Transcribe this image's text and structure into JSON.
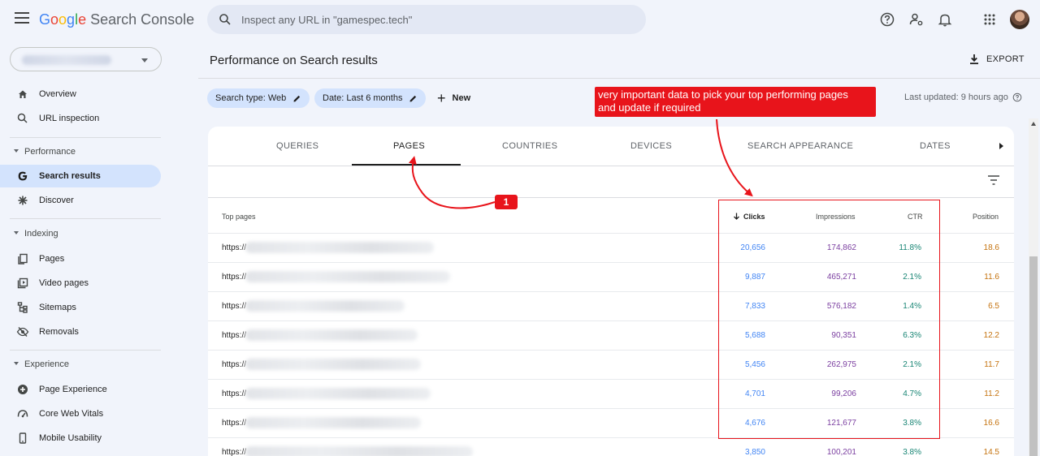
{
  "header": {
    "logo_google": [
      "G",
      "o",
      "o",
      "g",
      "l",
      "e"
    ],
    "logo_product": "Search Console",
    "search_placeholder": "Inspect any URL in \"gamespec.tech\""
  },
  "sidebar": {
    "items": [
      {
        "label": "Overview",
        "icon": "home-icon"
      },
      {
        "label": "URL inspection",
        "icon": "search-icon"
      }
    ],
    "sections": [
      {
        "label": "Performance",
        "items": [
          {
            "label": "Search results",
            "icon": "google-g-icon",
            "active": true
          },
          {
            "label": "Discover",
            "icon": "asterisk-icon"
          }
        ]
      },
      {
        "label": "Indexing",
        "items": [
          {
            "label": "Pages",
            "icon": "pages-icon"
          },
          {
            "label": "Video pages",
            "icon": "video-pages-icon"
          },
          {
            "label": "Sitemaps",
            "icon": "sitemap-icon"
          },
          {
            "label": "Removals",
            "icon": "removals-icon"
          }
        ]
      },
      {
        "label": "Experience",
        "items": [
          {
            "label": "Page Experience",
            "icon": "page-experience-icon"
          },
          {
            "label": "Core Web Vitals",
            "icon": "speed-gauge-icon"
          },
          {
            "label": "Mobile Usability",
            "icon": "phone-icon"
          }
        ]
      }
    ]
  },
  "main": {
    "title": "Performance on Search results",
    "export_label": "EXPORT",
    "chips": [
      "Search type: Web",
      "Date: Last 6 months"
    ],
    "new_label": "New",
    "last_updated": "Last updated: 9 hours ago",
    "annotation_text_line1": "very important data to pick your top performing pages",
    "annotation_text_line2": "and update if required",
    "annotation_badge": "1",
    "tabs": [
      "QUERIES",
      "PAGES",
      "COUNTRIES",
      "DEVICES",
      "SEARCH APPEARANCE",
      "DATES"
    ],
    "active_tab": "PAGES",
    "table": {
      "headers": {
        "pages": "Top pages",
        "clicks": "Clicks",
        "impressions": "Impressions",
        "ctr": "CTR",
        "position": "Position"
      },
      "rows": [
        {
          "url": "https://",
          "clicks": "20,656",
          "impressions": "174,862",
          "ctr": "11.8%",
          "position": "18.6"
        },
        {
          "url": "https://",
          "clicks": "9,887",
          "impressions": "465,271",
          "ctr": "2.1%",
          "position": "11.6"
        },
        {
          "url": "https://",
          "clicks": "7,833",
          "impressions": "576,182",
          "ctr": "1.4%",
          "position": "6.5"
        },
        {
          "url": "https://",
          "clicks": "5,688",
          "impressions": "90,351",
          "ctr": "6.3%",
          "position": "12.2"
        },
        {
          "url": "https://",
          "clicks": "5,456",
          "impressions": "262,975",
          "ctr": "2.1%",
          "position": "11.7"
        },
        {
          "url": "https://",
          "clicks": "4,701",
          "impressions": "99,206",
          "ctr": "4.7%",
          "position": "11.2"
        },
        {
          "url": "https://",
          "clicks": "4,676",
          "impressions": "121,677",
          "ctr": "3.8%",
          "position": "16.6"
        },
        {
          "url": "https://",
          "clicks": "3,850",
          "impressions": "100,201",
          "ctr": "3.8%",
          "position": "14.5"
        }
      ]
    }
  },
  "colors": {
    "accent_blue": "#4285f4",
    "impressions_purple": "#7b3fa0",
    "ctr_teal": "#188574",
    "position_orange": "#c5730f",
    "annotation_red": "#e8141b"
  }
}
